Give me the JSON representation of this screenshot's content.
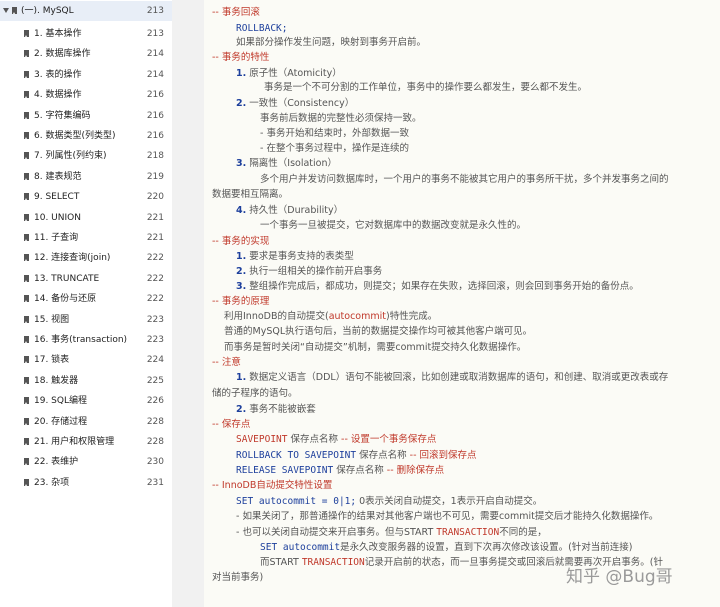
{
  "toc": {
    "top": {
      "label": "(一). MySQL",
      "page": "213"
    },
    "items": [
      {
        "label": "1. 基本操作",
        "page": "213"
      },
      {
        "label": "2. 数据库操作",
        "page": "214"
      },
      {
        "label": "3. 表的操作",
        "page": "214"
      },
      {
        "label": "4. 数据操作",
        "page": "216"
      },
      {
        "label": "5. 字符集编码",
        "page": "216"
      },
      {
        "label": "6. 数据类型(列类型)",
        "page": "216"
      },
      {
        "label": "7. 列属性(列约束)",
        "page": "218"
      },
      {
        "label": "8. 建表规范",
        "page": "219"
      },
      {
        "label": "9. SELECT",
        "page": "220"
      },
      {
        "label": "10. UNION",
        "page": "221"
      },
      {
        "label": "11. 子查询",
        "page": "221"
      },
      {
        "label": "12. 连接查询(join)",
        "page": "222"
      },
      {
        "label": "13. TRUNCATE",
        "page": "222"
      },
      {
        "label": "14. 备份与还原",
        "page": "222"
      },
      {
        "label": "15. 视图",
        "page": "223"
      },
      {
        "label": "16. 事务(transaction)",
        "page": "223"
      },
      {
        "label": "17. 锁表",
        "page": "224"
      },
      {
        "label": "18. 触发器",
        "page": "225"
      },
      {
        "label": "19. SQL编程",
        "page": "226"
      },
      {
        "label": "20. 存储过程",
        "page": "228"
      },
      {
        "label": "21. 用户和权限管理",
        "page": "228"
      },
      {
        "label": "22. 表维护",
        "page": "230"
      },
      {
        "label": "23. 杂项",
        "page": "231"
      }
    ]
  },
  "doc": {
    "l1": "-- 事务回滚",
    "l2": "ROLLBACK;",
    "l3": "如果部分操作发生问题，映射到事务开启前。",
    "l4": "-- 事务的特性",
    "l5n": "1.",
    "l5": "原子性（Atomicity）",
    "l6": "事务是一个不可分割的工作单位，事务中的操作要么都发生，要么都不发生。",
    "l7n": "2.",
    "l7": "一致性（Consistency）",
    "l8": "事务前后数据的完整性必须保持一致。",
    "l9": "- 事务开始和结束时，外部数据一致",
    "l10": "- 在整个事务过程中，操作是连续的",
    "l11n": "3.",
    "l11": "隔离性（Isolation）",
    "l12": "多个用户并发访问数据库时，一个用户的事务不能被其它用户的事务所干扰，多个并发事务之间的",
    "l13": "数据要相互隔离。",
    "l14n": "4.",
    "l14": "持久性（Durability）",
    "l15": "一个事务一旦被提交，它对数据库中的数据改变就是永久性的。",
    "l16": "-- 事务的实现",
    "l17n": "1.",
    "l17": "要求是事务支持的表类型",
    "l18n": "2.",
    "l18": "执行一组相关的操作前开启事务",
    "l19n": "3.",
    "l19": "整组操作完成后，都成功，则提交；如果存在失败，选择回滚，则会回到事务开始的备份点。",
    "l20": "-- 事务的原理",
    "l21a": "利用InnoDB的自动提交(",
    "l21b": "autocommit",
    "l21c": ")特性完成。",
    "l22": "普通的MySQL执行语句后，当前的数据提交操作均可被其他客户端可见。",
    "l23": "而事务是暂时关闭“自动提交”机制，需要commit提交持久化数据操作。",
    "l24": "-- 注意",
    "l25n": "1.",
    "l25": "数据定义语言（DDL）语句不能被回滚，比如创建或取消数据库的语句，和创建、取消或更改表或存",
    "l26": "储的子程序的语句。",
    "l27n": "2.",
    "l27": "事务不能被嵌套",
    "l28": "-- 保存点",
    "l29a": "SAVEPOINT",
    "l29b": " 保存点名称 ",
    "l29c": "-- 设置一个事务保存点",
    "l30a": "ROLLBACK TO SAVEPOINT",
    "l30b": " 保存点名称 ",
    "l30c": "-- 回滚到保存点",
    "l31a": "RELEASE SAVEPOINT",
    "l31b": " 保存点名称 ",
    "l31c": "-- 删除保存点",
    "l32": "-- InnoDB自动提交特性设置",
    "l33a": "SET autocommit = 0|1;",
    "l33b": "    0表示关闭自动提交，1表示开启自动提交。",
    "l34": "- 如果关闭了，那普通操作的结果对其他客户端也不可见，需要commit提交后才能持久化数据操作。",
    "l35a": "- 也可以关闭自动提交来开启事务。但与START ",
    "l35b": "TRANSACTION",
    "l35c": "不同的是，",
    "l36a": "SET autocommit",
    "l36b": "是永久改变服务器的设置，直到下次再次修改该设置。(针对当前连接)",
    "l37a": "而START ",
    "l37b": "TRANSACTION",
    "l37c": "记录开启前的状态，而一旦事务提交或回滚后就需要再次开启事务。(针",
    "l38": "对当前事务)"
  },
  "watermark": "知乎 @Bug哥"
}
